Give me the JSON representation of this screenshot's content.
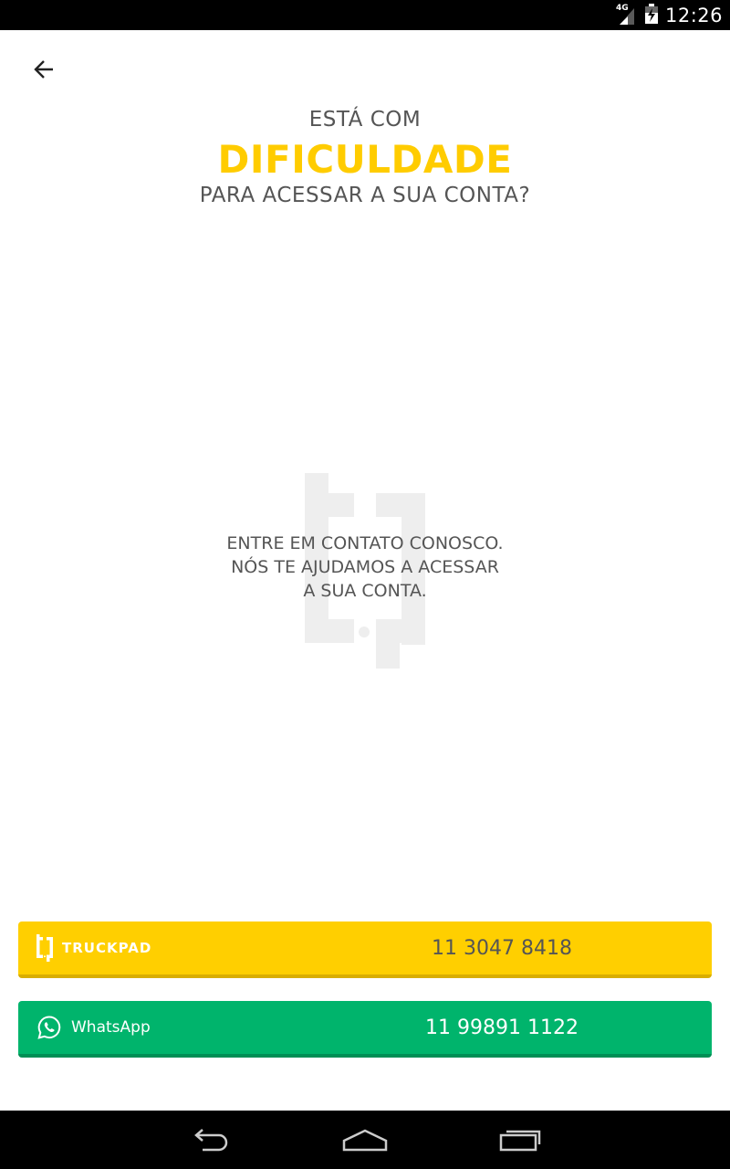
{
  "status_bar": {
    "network": "4G",
    "time": "12:26"
  },
  "header": {
    "line1": "ESTÁ COM",
    "line2": "DIFICULDADE",
    "line3": "PARA ACESSAR A SUA CONTA?"
  },
  "contact": {
    "lines": [
      "ENTRE EM CONTATO CONOSCO.",
      "NÓS TE AJUDAMOS A ACESSAR",
      "A SUA CONTA."
    ]
  },
  "buttons": {
    "truckpad": {
      "brand": "TRUCKPAD",
      "phone": "11 3047 8418",
      "color": "#FFCF00"
    },
    "whatsapp": {
      "brand": "WhatsApp",
      "phone": "11 99891 1122",
      "color": "#00B46C"
    }
  },
  "colors": {
    "accent": "#FFCC00",
    "text_gray": "#555555"
  }
}
